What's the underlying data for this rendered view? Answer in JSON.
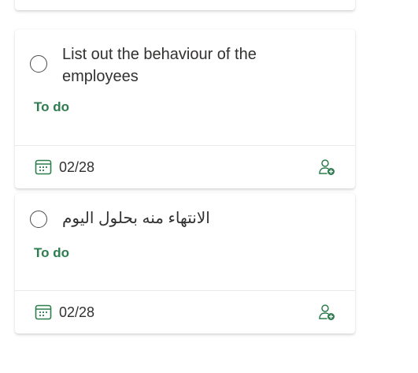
{
  "colors": {
    "accent_green": "#2e7d4f",
    "text": "#323130",
    "divider": "#e8e8e8"
  },
  "cards": [
    {
      "title": "List out the behaviour of the employees",
      "progress": "To do",
      "due_date": "02/28",
      "icons": [
        "calendar-icon",
        "assign-person-icon"
      ]
    },
    {
      "title": "الانتهاء منه بحلول اليوم",
      "progress": "To do",
      "due_date": "02/28",
      "icons": [
        "calendar-icon",
        "assign-person-icon"
      ]
    }
  ]
}
